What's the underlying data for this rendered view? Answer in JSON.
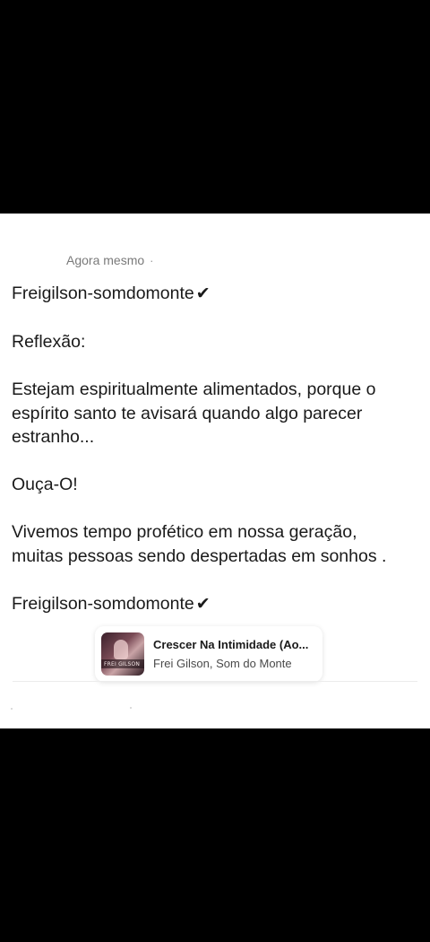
{
  "post": {
    "timestamp": "Agora mesmo",
    "separator": "·",
    "lines": [
      "Freigilson-somdomonte",
      "Reflexão:",
      "Estejam espiritualmente alimentados, porque o",
      "espírito santo te avisará quando algo parecer",
      "estranho...",
      "Ouça-O!",
      "Vivemos tempo profético em nossa geração,",
      "muitas pessoas sendo despertadas em sonhos .",
      "Freigilson-somdomonte"
    ],
    "check_mark": "✔"
  },
  "music": {
    "title": "Crescer Na Intimidade (Ao...",
    "artist": "Frei Gilson, Som do Monte",
    "cover_label": "FREI GILSON"
  },
  "icons": {
    "check": "check-icon"
  }
}
